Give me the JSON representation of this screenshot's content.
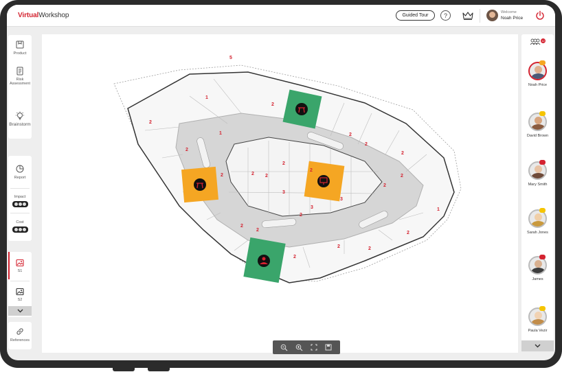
{
  "header": {
    "logo_accent": "Virtual",
    "logo_rest": "Workshop",
    "guided_tour_label": "Guided Tour",
    "help_glyph": "?",
    "welcome_text": "Welcome",
    "user_name": "Noah Price"
  },
  "left_toolbar": {
    "product_label": "Product",
    "risk_label": "Risk\nAssessment",
    "brainstorm_label": "Brainstorm",
    "report_label": "Report",
    "impact_label": "Impact",
    "cost_label": "Cost",
    "slide1_label": "S1",
    "slide2_label": "S2",
    "references_label": "References"
  },
  "floor_plan": {
    "zone_numbers": [
      "5",
      "1",
      "2",
      "2",
      "2",
      "1",
      "2",
      "2",
      "2",
      "2",
      "2",
      "2",
      "2",
      "3",
      "3",
      "3",
      "2",
      "2",
      "2",
      "2",
      "2",
      "2",
      "2",
      "1",
      "2",
      "2",
      "2"
    ],
    "markers": [
      {
        "zone_color": "#3aa56b",
        "icon": "stool-icon"
      },
      {
        "zone_color": "#f5a623",
        "icon": "stool-icon"
      },
      {
        "zone_color": "#f5a623",
        "icon": "monitor-icon"
      },
      {
        "zone_color": "#3aa56b",
        "icon": "people-icon"
      }
    ]
  },
  "team": {
    "count_badge": "12",
    "members": [
      {
        "name": "Noah Price",
        "badge_color": "#f5a623",
        "face": "#e0b08f",
        "body": "#4b5a77",
        "is_current_user": true
      },
      {
        "name": "David Brown",
        "badge_color": "#f5c400",
        "face": "#d7a47e",
        "body": "#8a5b3f"
      },
      {
        "name": "Mary Smith",
        "badge_color": "#d42330",
        "face": "#e8c3a5",
        "body": "#6e4a39"
      },
      {
        "name": "Sarah Jones",
        "badge_color": "#f5c400",
        "face": "#f0cfa8",
        "body": "#c9993d"
      },
      {
        "name": "James",
        "badge_color": "#d42330",
        "face": "#d9b08f",
        "body": "#3d3d3d"
      },
      {
        "name": "Paula Vezir",
        "badge_color": "#f5c400",
        "face": "#f1d2b3",
        "body": "#c28d4a"
      }
    ]
  },
  "zoom_controls": [
    "zoom-out-icon",
    "zoom-in-icon",
    "fit-screen-icon",
    "save-icon"
  ]
}
